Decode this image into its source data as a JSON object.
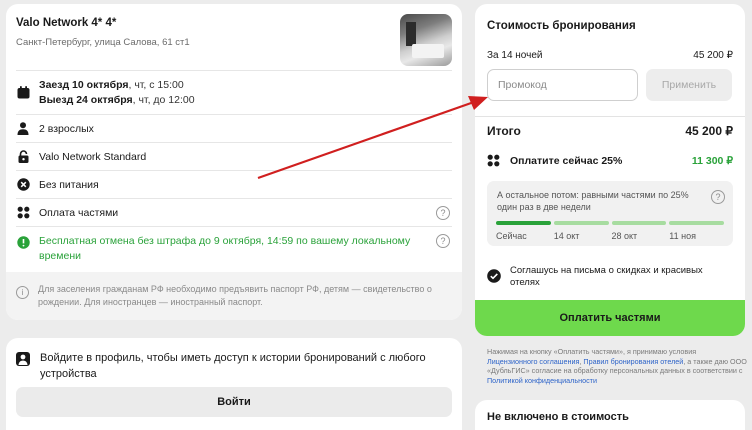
{
  "booking": {
    "hotel_name": "Valo Network 4* 4*",
    "address": "Санкт-Петербург, улица Салова, 61 ст1",
    "checkin_label": "Заезд 10 октября",
    "checkin_detail": ", чт, с 15:00",
    "checkout_label": "Выезд 24 октября",
    "checkout_detail": ", чт, до 12:00",
    "guests": "2 взрослых",
    "room": "Valo Network Standard",
    "meals": "Без питания",
    "installments": "Оплата частями",
    "cancellation": "Бесплатная отмена без штрафа до 9 октября, 14:59 по вашему локальному времени",
    "notice": "Для заселения гражданам РФ необходимо предъявить паспорт РФ, детям — свидетельство о рождении. Для иностранцев — иностранный паспорт."
  },
  "login": {
    "text": "Войдите в профиль, чтобы иметь доступ к истории бронирований с любого устройства",
    "button_label": "Войти"
  },
  "price": {
    "title": "Стоимость бронирования",
    "nights_label": "За 14 ночей",
    "nights_value": "45 200 ₽",
    "promo_placeholder": "Промокод",
    "apply_label": "Применить",
    "total_label": "Итого",
    "total_value": "45 200 ₽",
    "pay_now_label": "Оплатите сейчас 25%",
    "pay_now_value": "11 300 ₽",
    "schedule_text": "А остальное потом: равными частями по 25% один раз в две недели",
    "schedule": [
      {
        "label": "Сейчас",
        "paid": true
      },
      {
        "label": "14 окт",
        "paid": false
      },
      {
        "label": "28 окт",
        "paid": false
      },
      {
        "label": "11 ноя",
        "paid": false
      }
    ],
    "consent_text": "Соглашусь на письма о скидках и красивых отелях",
    "pay_button_label": "Оплатить частями"
  },
  "legal": {
    "part1": "Нажимая на кнопку «Оплатить частями», я принимаю условия ",
    "link1": "Лицензионного соглашения",
    "part2": ", ",
    "link2": "Правил бронирования отелей",
    "part3": ", а также даю ООО «ДубльГИС» согласие на обработку персональных данных в соответствии с ",
    "link3": "Политикой конфиденциальности"
  },
  "excluded": {
    "title": "Не включено в стоимость"
  },
  "colors": {
    "accent_green": "#6ed94c",
    "success_green": "#2aa23a",
    "annotation_arrow": "#d01f1f"
  }
}
